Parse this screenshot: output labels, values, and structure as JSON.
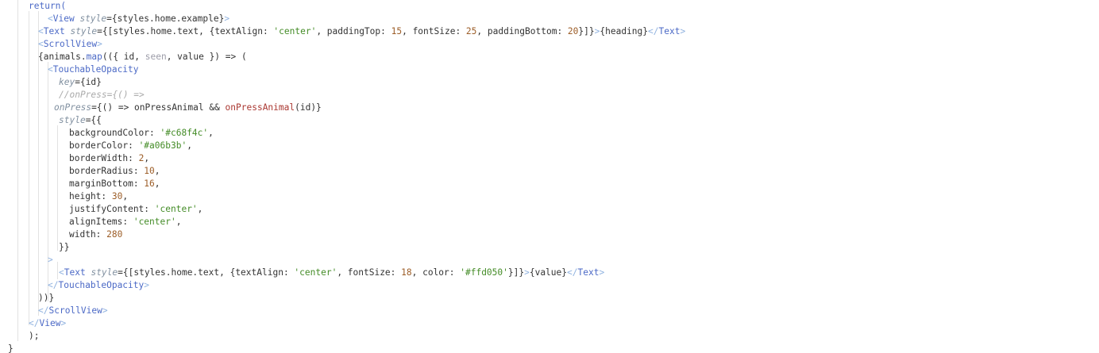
{
  "editor": {
    "colors": {
      "keyword": "#4b69c6",
      "tag_bracket": "#91b3e0",
      "attribute": "#8190a0",
      "string": "#448c27",
      "number": "#9c5d27",
      "comment": "#aaaaaa",
      "function_call": "#aa3731",
      "text": "#333333"
    },
    "lines": [
      {
        "indent": 36,
        "tokens": [
          {
            "t": "return(",
            "c": "keyword"
          }
        ]
      },
      {
        "indent": 60,
        "tokens": [
          {
            "t": "<",
            "c": "tagbracket"
          },
          {
            "t": "View",
            "c": "tagname"
          },
          {
            "t": " ",
            "c": "default"
          },
          {
            "t": "style",
            "c": "attr"
          },
          {
            "t": "={styles.home.example}",
            "c": "default"
          },
          {
            "t": ">",
            "c": "tagbracket"
          }
        ]
      },
      {
        "indent": 48,
        "tokens": [
          {
            "t": "<",
            "c": "tagbracket"
          },
          {
            "t": "Text",
            "c": "tagname"
          },
          {
            "t": " ",
            "c": "default"
          },
          {
            "t": "style",
            "c": "attr"
          },
          {
            "t": "={[styles.home.text, {textAlign: ",
            "c": "default"
          },
          {
            "t": "'center'",
            "c": "string"
          },
          {
            "t": ", paddingTop: ",
            "c": "default"
          },
          {
            "t": "15",
            "c": "number"
          },
          {
            "t": ", fontSize: ",
            "c": "default"
          },
          {
            "t": "25",
            "c": "number"
          },
          {
            "t": ", paddingBottom: ",
            "c": "default"
          },
          {
            "t": "20",
            "c": "number"
          },
          {
            "t": "}]}",
            "c": "default"
          },
          {
            "t": ">",
            "c": "tagbracket"
          },
          {
            "t": "{heading}",
            "c": "default"
          },
          {
            "t": "</",
            "c": "tagbracket"
          },
          {
            "t": "Text",
            "c": "tagname"
          },
          {
            "t": ">",
            "c": "tagbracket"
          }
        ]
      },
      {
        "indent": 48,
        "tokens": [
          {
            "t": "<",
            "c": "tagbracket"
          },
          {
            "t": "ScrollView",
            "c": "tagname"
          },
          {
            "t": ">",
            "c": "tagbracket"
          }
        ]
      },
      {
        "indent": 48,
        "tokens": [
          {
            "t": "{animals.",
            "c": "default"
          },
          {
            "t": "map",
            "c": "method"
          },
          {
            "t": "(({ id, ",
            "c": "default"
          },
          {
            "t": "seen",
            "c": "param"
          },
          {
            "t": ", value }) => (",
            "c": "default"
          }
        ]
      },
      {
        "indent": 60,
        "tokens": [
          {
            "t": "<",
            "c": "tagbracket"
          },
          {
            "t": "TouchableOpacity",
            "c": "tagname"
          }
        ]
      },
      {
        "indent": 74,
        "tokens": [
          {
            "t": "key",
            "c": "attr"
          },
          {
            "t": "={id}",
            "c": "default"
          }
        ]
      },
      {
        "indent": 74,
        "tokens": [
          {
            "t": "//onPress={() =>",
            "c": "comment"
          }
        ]
      },
      {
        "indent": 68,
        "tokens": [
          {
            "t": "onPress",
            "c": "attr"
          },
          {
            "t": "={() => onPressAnimal && ",
            "c": "default"
          },
          {
            "t": "onPressAnimal",
            "c": "func"
          },
          {
            "t": "(id)}",
            "c": "default"
          }
        ]
      },
      {
        "indent": 74,
        "tokens": [
          {
            "t": "style",
            "c": "attr"
          },
          {
            "t": "={{",
            "c": "default"
          }
        ]
      },
      {
        "indent": 87,
        "tokens": [
          {
            "t": "backgroundColor: ",
            "c": "default"
          },
          {
            "t": "'#c68f4c'",
            "c": "string"
          },
          {
            "t": ",",
            "c": "default"
          }
        ]
      },
      {
        "indent": 87,
        "tokens": [
          {
            "t": "borderColor: ",
            "c": "default"
          },
          {
            "t": "'#a06b3b'",
            "c": "string"
          },
          {
            "t": ",",
            "c": "default"
          }
        ]
      },
      {
        "indent": 87,
        "tokens": [
          {
            "t": "borderWidth: ",
            "c": "default"
          },
          {
            "t": "2",
            "c": "number"
          },
          {
            "t": ",",
            "c": "default"
          }
        ]
      },
      {
        "indent": 87,
        "tokens": [
          {
            "t": "borderRadius: ",
            "c": "default"
          },
          {
            "t": "10",
            "c": "number"
          },
          {
            "t": ",",
            "c": "default"
          }
        ]
      },
      {
        "indent": 87,
        "tokens": [
          {
            "t": "marginBottom: ",
            "c": "default"
          },
          {
            "t": "16",
            "c": "number"
          },
          {
            "t": ",",
            "c": "default"
          }
        ]
      },
      {
        "indent": 87,
        "tokens": [
          {
            "t": "height: ",
            "c": "default"
          },
          {
            "t": "30",
            "c": "number"
          },
          {
            "t": ",",
            "c": "default"
          }
        ]
      },
      {
        "indent": 87,
        "tokens": [
          {
            "t": "justifyContent: ",
            "c": "default"
          },
          {
            "t": "'center'",
            "c": "string"
          },
          {
            "t": ",",
            "c": "default"
          }
        ]
      },
      {
        "indent": 87,
        "tokens": [
          {
            "t": "alignItems: ",
            "c": "default"
          },
          {
            "t": "'center'",
            "c": "string"
          },
          {
            "t": ",",
            "c": "default"
          }
        ]
      },
      {
        "indent": 87,
        "tokens": [
          {
            "t": "width: ",
            "c": "default"
          },
          {
            "t": "280",
            "c": "number"
          }
        ]
      },
      {
        "indent": 74,
        "tokens": [
          {
            "t": "}}",
            "c": "default"
          }
        ]
      },
      {
        "indent": 60,
        "tokens": [
          {
            "t": ">",
            "c": "tagbracket"
          }
        ]
      },
      {
        "indent": 74,
        "tokens": [
          {
            "t": "<",
            "c": "tagbracket"
          },
          {
            "t": "Text",
            "c": "tagname"
          },
          {
            "t": " ",
            "c": "default"
          },
          {
            "t": "style",
            "c": "attr"
          },
          {
            "t": "={[styles.home.text, {textAlign: ",
            "c": "default"
          },
          {
            "t": "'center'",
            "c": "string"
          },
          {
            "t": ", fontSize: ",
            "c": "default"
          },
          {
            "t": "18",
            "c": "number"
          },
          {
            "t": ", color: ",
            "c": "default"
          },
          {
            "t": "'#ffd050'",
            "c": "string"
          },
          {
            "t": "}]}",
            "c": "default"
          },
          {
            "t": ">",
            "c": "tagbracket"
          },
          {
            "t": "{value}",
            "c": "default"
          },
          {
            "t": "</",
            "c": "tagbracket"
          },
          {
            "t": "Text",
            "c": "tagname"
          },
          {
            "t": ">",
            "c": "tagbracket"
          }
        ]
      },
      {
        "indent": 60,
        "tokens": [
          {
            "t": "</",
            "c": "tagbracket"
          },
          {
            "t": "TouchableOpacity",
            "c": "tagname"
          },
          {
            "t": ">",
            "c": "tagbracket"
          }
        ]
      },
      {
        "indent": 48,
        "tokens": [
          {
            "t": "))}",
            "c": "default"
          }
        ]
      },
      {
        "indent": 48,
        "tokens": [
          {
            "t": "</",
            "c": "tagbracket"
          },
          {
            "t": "ScrollView",
            "c": "tagname"
          },
          {
            "t": ">",
            "c": "tagbracket"
          }
        ]
      },
      {
        "indent": 36,
        "tokens": [
          {
            "t": "</",
            "c": "tagbracket"
          },
          {
            "t": "View",
            "c": "tagname"
          },
          {
            "t": ">",
            "c": "tagbracket"
          }
        ]
      },
      {
        "indent": 36,
        "tokens": [
          {
            "t": ");",
            "c": "default"
          }
        ]
      },
      {
        "indent": 10,
        "tokens": [
          {
            "t": "}",
            "c": "default"
          }
        ]
      }
    ]
  }
}
